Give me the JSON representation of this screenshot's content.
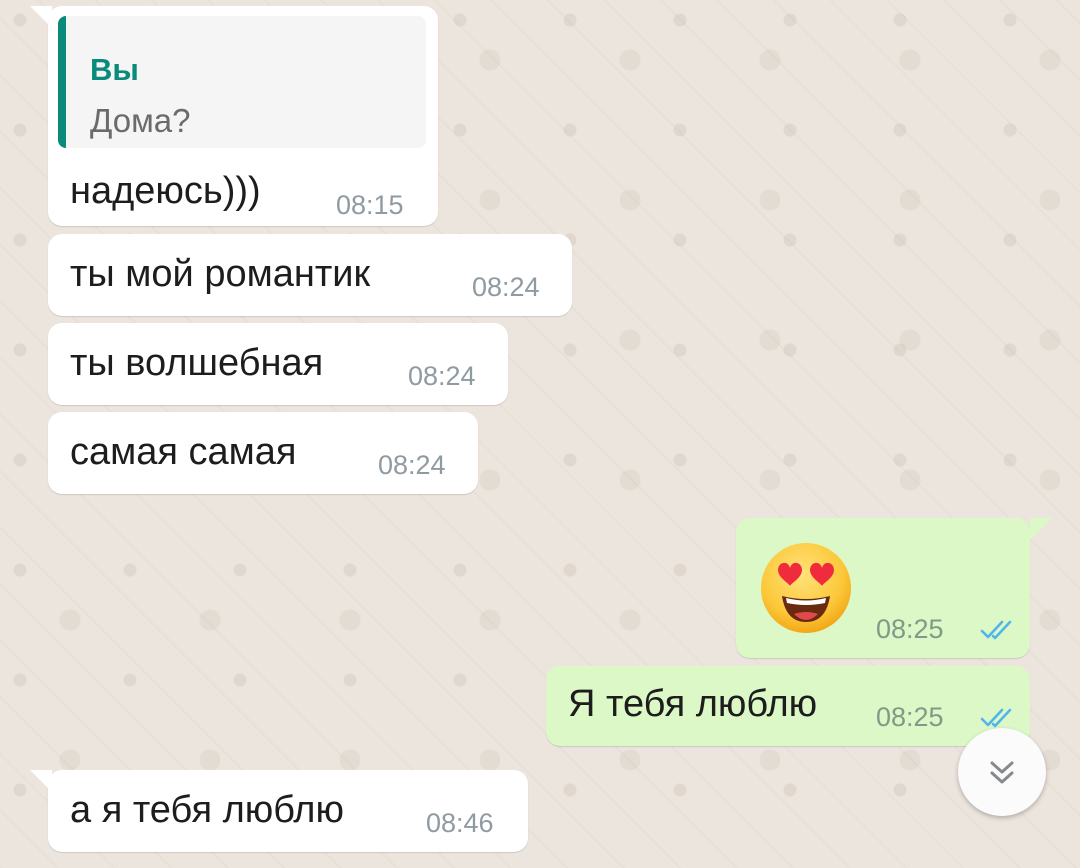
{
  "chat": {
    "quoted_reply": {
      "author": "Вы",
      "text": "Дома?"
    },
    "messages": [
      {
        "direction": "incoming",
        "text": "надеюсь)))",
        "time": "08:15"
      },
      {
        "direction": "incoming",
        "text": "ты мой романтик",
        "time": "08:24"
      },
      {
        "direction": "incoming",
        "text": "ты волшебная",
        "time": "08:24"
      },
      {
        "direction": "incoming",
        "text": "самая самая",
        "time": "08:24"
      },
      {
        "direction": "outgoing",
        "text": "",
        "emoji": "heart-eyes-emoji",
        "time": "08:25",
        "status": "read"
      },
      {
        "direction": "outgoing",
        "text": "Я тебя люблю",
        "time": "08:25",
        "status": "read"
      },
      {
        "direction": "incoming",
        "text": "а я тебя люблю",
        "time": "08:46"
      }
    ]
  },
  "icons": {
    "read_ticks": "double-check-icon",
    "scroll_down": "double-chevron-down-icon"
  },
  "colors": {
    "wallpaper": "#ece5dd",
    "incoming_bubble": "#ffffff",
    "outgoing_bubble": "#dcf8c6",
    "quote_accent": "#0a8a7a",
    "read_ticks": "#4fb6ec"
  }
}
